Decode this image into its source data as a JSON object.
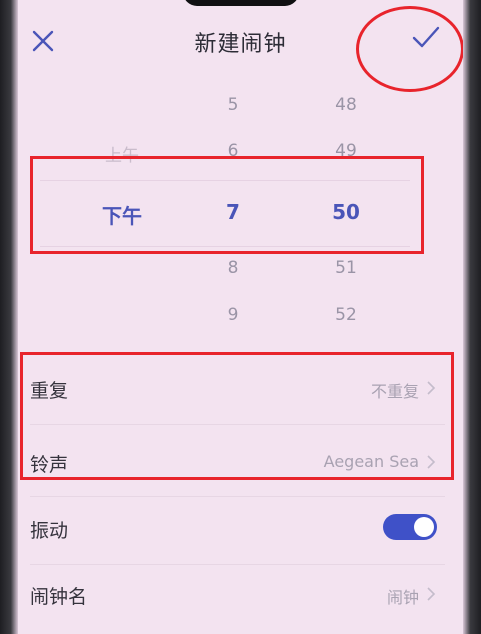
{
  "header": {
    "title": "新建闹钟",
    "close_icon": "close-icon",
    "confirm_icon": "checkmark-icon"
  },
  "picker": {
    "period": {
      "above": "上午",
      "selected": "下午"
    },
    "hour": {
      "above2": "5",
      "above1": "6",
      "selected": "7",
      "below1": "8",
      "below2": "9"
    },
    "minute": {
      "above2": "48",
      "above1": "49",
      "selected": "50",
      "below1": "51",
      "below2": "52"
    }
  },
  "settings": {
    "repeat": {
      "label": "重复",
      "value": "不重复"
    },
    "ringtone": {
      "label": "铃声",
      "value": "Aegean Sea"
    },
    "vibrate": {
      "label": "振动",
      "enabled": true
    },
    "alarm_name": {
      "label": "闹钟名",
      "value": "闹钟"
    }
  },
  "colors": {
    "accent": "#3f51c8",
    "selected_text": "#4a55b8",
    "annotation": "#e8242c",
    "background": "#f3e3f0"
  }
}
